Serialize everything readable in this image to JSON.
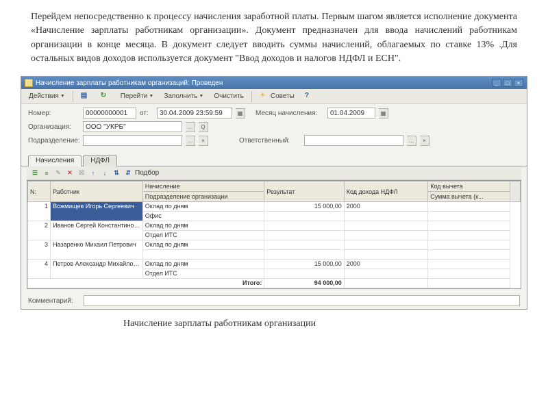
{
  "paragraph": "Перейдем непосредственно к процессу начисления заработной платы. Первым шагом является исполнение документа «Начисление зарплаты работникам организации». Документ предназначен для ввода начислений работникам организации в конце месяца. В документ следует вводить суммы начислений, облагаемых по ставке 13% .Для остальных видов доходов используется документ \"Ввод доходов и налогов НДФЛ и ЕСН\".",
  "caption": "Начисление зарплаты работникам организации",
  "window": {
    "title": "Начисление зарплаты работникам организаций: Проведен",
    "toolbar": {
      "actions": "Действия",
      "go": "Перейти",
      "fill": "Заполнить",
      "clear": "Очистить",
      "tips": "Советы"
    },
    "fields": {
      "number_label": "Номер:",
      "number": "00000000001",
      "from_label": "от:",
      "date": "30.04.2009 23:59:59",
      "month_label": "Месяц начисления:",
      "month": "01.04.2009",
      "org_label": "Организация:",
      "org": "ООО \"УКРБ\"",
      "dept_label": "Подразделение:",
      "dept": "",
      "responsible_label": "Ответственный:",
      "responsible": "",
      "comment_label": "Комментарий:",
      "comment": ""
    },
    "tabs": {
      "t1": "Начисления",
      "t2": "НДФЛ"
    },
    "table_toolbar": {
      "selection": "Подбор"
    },
    "table": {
      "headers": {
        "n": "N:",
        "employee": "Работник",
        "charge": "Начисление",
        "charge_sub": "Подразделение организации",
        "result": "Результат",
        "income_code": "Код дохода НДФЛ",
        "deduct_code": "Код вычета",
        "deduct_sum": "Сумма вычета (к..."
      },
      "rows": [
        {
          "n": "1",
          "emp": "Вожмищев Игорь Сергеевич",
          "charge": "Оклад по дням",
          "dept": "Офис",
          "result": "15 000,00",
          "code": "2000"
        },
        {
          "n": "2",
          "emp": "Иванов Сергей Константинович",
          "charge": "Оклад по дням",
          "dept": "Отдел ИТС",
          "result": "",
          "code": ""
        },
        {
          "n": "3",
          "emp": "Назаренко Михаил Петрович",
          "charge": "Оклад по дням",
          "dept": "",
          "result": "",
          "code": ""
        },
        {
          "n": "4",
          "emp": "Петров Александр Михайлович",
          "charge": "Оклад по дням",
          "dept": "Отдел ИТС",
          "result": "15 000,00",
          "code": "2000"
        }
      ],
      "total_label": "Итого:",
      "total": "94 000,00"
    }
  }
}
